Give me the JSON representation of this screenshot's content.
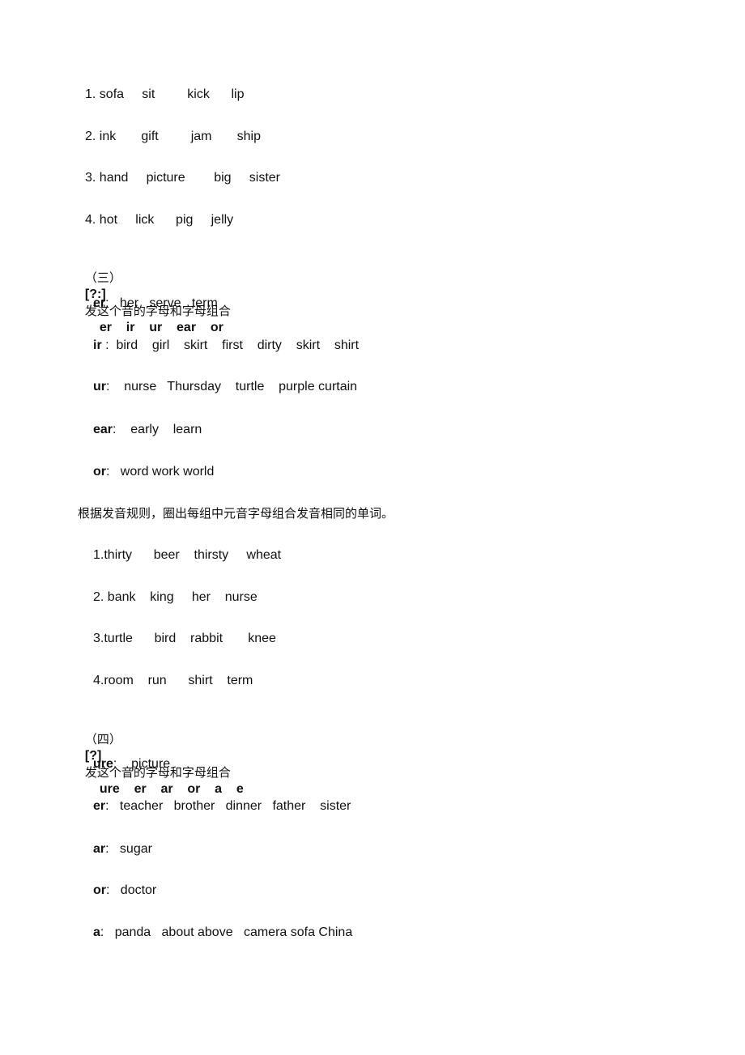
{
  "section_two_list": [
    "1. sofa     sit         kick      lip",
    "2. ink       gift         jam       ship",
    "3. hand     picture        big     sister",
    "4. hot     lick      pig     jelly"
  ],
  "section_three": {
    "number": "（三）",
    "symbol": "[?:]",
    "title": "发这个音的字母和字母组合",
    "combos": "er    ir    ur    ear    or",
    "rows": [
      {
        "key": "er",
        "sep": ":",
        "words": "   her   serve   term"
      },
      {
        "key": "ir",
        "sep": " :",
        "words": "  bird    girl    skirt    first    dirty    skirt    shirt"
      },
      {
        "key": "ur",
        "sep": ":",
        "words": "    nurse   Thursday    turtle    purple curtain"
      },
      {
        "key": "ear",
        "sep": ":",
        "words": "    early    learn"
      },
      {
        "key": "or",
        "sep": ":",
        "words": "   word work world"
      }
    ]
  },
  "exercise": {
    "instruction": "根据发音规则，圈出每组中元音字母组合发音相同的单词。",
    "items": [
      "1.thirty      beer    thirsty     wheat",
      "2. bank    king     her    nurse",
      "3.turtle      bird    rabbit       knee",
      "4.room    run      shirt    term"
    ]
  },
  "section_four": {
    "number": "（四）",
    "symbol": "[?]",
    "title": "发这个音的字母和字母组合",
    "combos": "ure    er    ar    or    a    e",
    "rows": [
      {
        "key": "ure",
        "sep": ":",
        "words": "    picture"
      },
      {
        "key": "er",
        "sep": ":",
        "words": "   teacher   brother   dinner   father    sister"
      },
      {
        "key": "ar",
        "sep": ":",
        "words": "   sugar"
      },
      {
        "key": "or",
        "sep": ":",
        "words": "   doctor"
      },
      {
        "key": "a",
        "sep": ":",
        "words": "   panda   about above   camera sofa China"
      }
    ]
  }
}
